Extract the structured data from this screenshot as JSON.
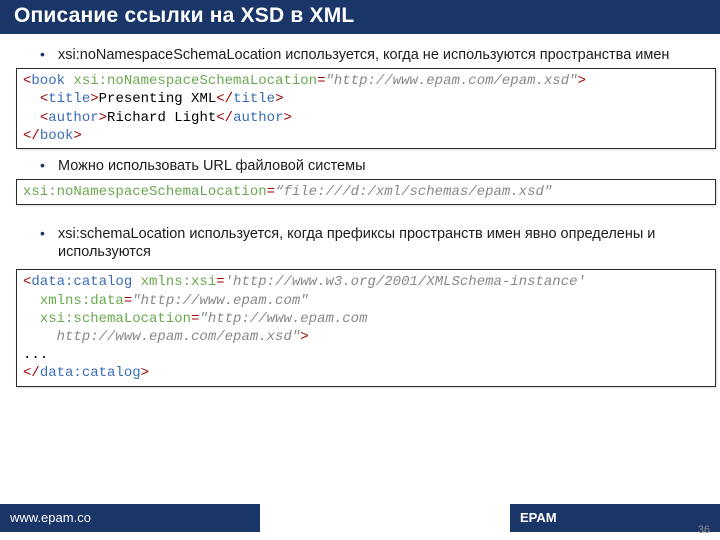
{
  "title": "Описание ссылки на XSD в XML",
  "bullets": {
    "b1": "xsi:noNamespaceSchemaLocation используется, когда не используются пространства имен",
    "b2": "Можно использовать URL файловой системы",
    "b3": "xsi:schemaLocation используется, когда префиксы пространств имен явно определены и используются"
  },
  "code1": {
    "l1": {
      "open": "<",
      "tag": "book ",
      "attr": "xsi:noNamespaceSchemaLocation",
      "eq": "=",
      "val": "\"http://www.epam.com/epam.xsd\"",
      "close": ">"
    },
    "l2": {
      "indent": "  ",
      "o1": "<",
      "t1": "title",
      "c1": ">",
      "txt": "Presenting XML",
      "o2": "</",
      "t2": "title",
      "c2": ">"
    },
    "l3": {
      "indent": "  ",
      "o1": "<",
      "t1": "author",
      "c1": ">",
      "txt": "Richard Light",
      "o2": "</",
      "t2": "author",
      "c2": ">"
    },
    "l4": {
      "o1": "</",
      "t1": "book",
      "c1": ">"
    }
  },
  "code2": {
    "attr": "xsi:noNamespaceSchemaLocation",
    "eq": "=",
    "val": "“file:///d:/xml/schemas/epam.xsd\""
  },
  "code3": {
    "l1": {
      "open": "<",
      "tag": "data:catalog ",
      "attr": "xmlns:xsi",
      "eq": "=",
      "val": "'http://www.w3.org/2001/XMLSchema-instance'"
    },
    "l2": {
      "indent": "  ",
      "attr": "xmlns:data",
      "eq": "=",
      "val": "\"http://www.epam.com\""
    },
    "l3": {
      "indent": "  ",
      "attr": "xsi:schemaLocation",
      "eq": "=",
      "val": "\"http://www.epam.com"
    },
    "l4": {
      "indent": "    ",
      "val": "http://www.epam.com/epam.xsd\"",
      "close": ">"
    },
    "l5": {
      "txt": "..."
    },
    "l6": {
      "o1": "</",
      "t1": "data:catalog",
      "c1": ">"
    }
  },
  "footer": {
    "site": "www.epam.co",
    "brand": "EPAM",
    "page": "36"
  }
}
